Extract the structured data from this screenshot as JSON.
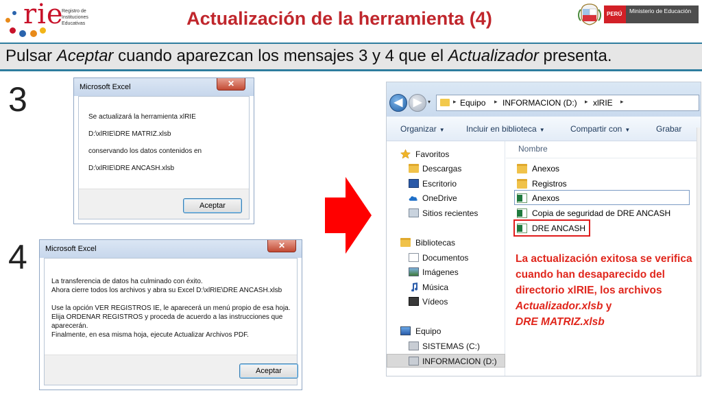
{
  "header": {
    "logo_text": "rie",
    "logo_subtitle": "Registro de Instituciones Educativas",
    "title": "Actualización de la herramienta (4)",
    "ministry_country": "PERÚ",
    "ministry_name": "Ministerio de Educación"
  },
  "instruction": {
    "part1": "Pulsar ",
    "part2": "Aceptar",
    "part3": " cuando aparezcan los mensajes 3 y 4 que el ",
    "part4": "Actualizador",
    "part5": " presenta."
  },
  "step3": {
    "number": "3",
    "title": "Microsoft Excel",
    "close_glyph": "✕",
    "lines": [
      "Se actualizará la herramienta xlRIE",
      "D:\\xlRIE\\DRE MATRIZ.xlsb",
      "conservando los datos contenidos en",
      "D:\\xlRIE\\DRE ANCASH.xlsb"
    ],
    "button": "Aceptar"
  },
  "step4": {
    "number": "4",
    "title": "Microsoft Excel",
    "close_glyph": "✕",
    "lines": [
      "La transferencia de datos ha culminado con éxito.",
      "Ahora cierre todos los archivos y abra su Excel D:\\xlRIE\\DRE ANCASH.xlsb",
      "Use la opción VER REGISTROS IE, le aparecerá un menú propio de esa hoja.",
      "Elija ORDENAR REGISTROS y proceda de acuerdo a las instrucciones que",
      "aparecerán.",
      "Finalmente, en esa misma hoja, ejecute Actualizar Archivos PDF."
    ],
    "button": "Aceptar"
  },
  "explorer": {
    "breadcrumbs": [
      "Equipo",
      "INFORMACION (D:)",
      "xlRIE"
    ],
    "nav_back_glyph": "◀",
    "nav_fwd_glyph": "▶",
    "nav_drop_glyph": "▾",
    "crumb_sep_glyph": "▸",
    "toolbar": [
      "Organizar",
      "Incluir en biblioteca",
      "Compartir con",
      "Grabar"
    ],
    "toolbar_caret": "▼",
    "nav": [
      {
        "label": "Favoritos",
        "icon": "star-icon"
      },
      {
        "label": "Descargas",
        "icon": "downloads-folder-icon"
      },
      {
        "label": "Escritorio",
        "icon": "desktop-icon"
      },
      {
        "label": "OneDrive",
        "icon": "cloud-icon"
      },
      {
        "label": "Sitios recientes",
        "icon": "recent-places-icon"
      },
      {
        "label": "Bibliotecas",
        "icon": "libraries-icon"
      },
      {
        "label": "Documentos",
        "icon": "documents-icon"
      },
      {
        "label": "Imágenes",
        "icon": "pictures-icon"
      },
      {
        "label": "Música",
        "icon": "music-icon"
      },
      {
        "label": "Vídeos",
        "icon": "videos-icon"
      },
      {
        "label": "Equipo",
        "icon": "computer-icon"
      },
      {
        "label": "SISTEMAS (C:)",
        "icon": "drive-c-icon"
      },
      {
        "label": "INFORMACION (D:)",
        "icon": "drive-d-icon"
      }
    ],
    "column_header": "Nombre",
    "files": [
      {
        "name": "Anexos",
        "type": "folder"
      },
      {
        "name": "Registros",
        "type": "folder"
      },
      {
        "name": "Anexos",
        "type": "excel"
      },
      {
        "name": "Copia de seguridad de DRE ANCASH",
        "type": "excel"
      },
      {
        "name": "DRE ANCASH",
        "type": "excel"
      }
    ],
    "note": {
      "line1": "La actualización exitosa se verifica cuando han desaparecido del directorio xlRIE, los archivos",
      "file1": "Actualizador.xlsb",
      "and": " y",
      "file2": "DRE MATRIZ.xlsb"
    }
  },
  "colors": {
    "title_red": "#c0262c",
    "accent_blue": "#2e7d9e",
    "arrow_red": "#ff0000",
    "note_red": "#e0261c"
  }
}
